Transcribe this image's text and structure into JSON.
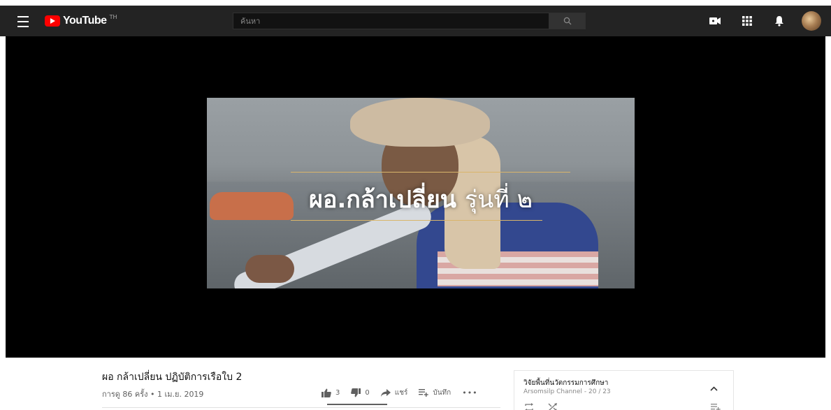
{
  "header": {
    "logo_text": "YouTube",
    "logo_country": "TH",
    "search_placeholder": "ค้นหา"
  },
  "icons": {
    "menu": "hamburger-menu-icon",
    "search": "search-icon",
    "upload": "video-camera-icon",
    "apps": "apps-grid-icon",
    "notifications": "bell-icon"
  },
  "video": {
    "overlay_bold": "ผอ.กล้าเปลี่ยน",
    "overlay_thin": "รุ่นที่ ๒",
    "title": "ผอ กล้าเปลี่ยน ปฏิบัติการเรือใบ 2",
    "views_date": "การดู 86 ครั้ง • 1 เม.ย. 2019"
  },
  "actions": {
    "like_count": "3",
    "dislike_count": "0",
    "share_label": "แชร์",
    "save_label": "บันทึก",
    "more_label": "•••",
    "like_ratio": 1.0
  },
  "playlist": {
    "title": "วิจัยพื้นที่นวัตกรรมการศึกษา",
    "subtitle": "Arsomsilp Channel - 20 / 23"
  },
  "colors": {
    "masthead": "#232323",
    "logo_red": "#ff0000",
    "player_bg": "#000000",
    "accent_line": "#d9b56a"
  }
}
